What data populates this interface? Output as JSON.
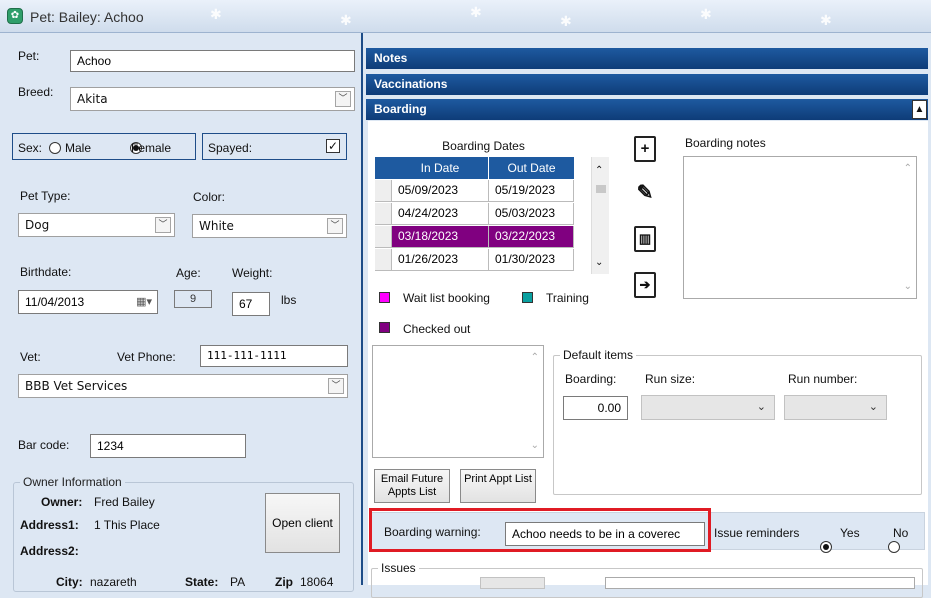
{
  "window": {
    "title": "Pet: Bailey: Achoo"
  },
  "pet": {
    "pet_label": "Pet:",
    "pet_value": "Achoo",
    "breed_label": "Breed:",
    "breed_value": "Akita",
    "sex_label": "Sex:",
    "sex_male": "Male",
    "sex_female": "Female",
    "sex_selected": "Female",
    "spayed_label": "Spayed:",
    "spayed_checked": true,
    "pet_type_label": "Pet Type:",
    "pet_type_value": "Dog",
    "color_label": "Color:",
    "color_value": "White",
    "birthdate_label": "Birthdate:",
    "birthdate_value": "11/04/2013",
    "age_label": "Age:",
    "age_value": "9",
    "weight_label": "Weight:",
    "weight_value": "67",
    "weight_unit": "lbs",
    "vet_label": "Vet:",
    "vet_phone_label": "Vet Phone:",
    "vet_phone_value": "111-111-1111",
    "vet_value": "BBB Vet Services",
    "barcode_label": "Bar code:",
    "barcode_value": "1234"
  },
  "owner": {
    "group_title": "Owner Information",
    "owner_label": "Owner:",
    "owner_value": "Fred Bailey",
    "address1_label": "Address1:",
    "address1_value": "1 This Place",
    "address2_label": "Address2:",
    "address2_value": "",
    "open_client_label": "Open client",
    "city_label": "City:",
    "city_value": "nazareth",
    "state_label": "State:",
    "state_value": "PA",
    "zip_label": "Zip",
    "zip_value": "18064"
  },
  "sections": {
    "notes": "Notes",
    "vaccinations": "Vaccinations",
    "boarding": "Boarding"
  },
  "boarding": {
    "dates_title": "Boarding Dates",
    "col_in": "In Date",
    "col_out": "Out Date",
    "rows": [
      {
        "in": "05/09/2023",
        "out": "05/19/2023",
        "kind": "normal"
      },
      {
        "in": "04/24/2023",
        "out": "05/03/2023",
        "kind": "normal"
      },
      {
        "in": "03/18/2023",
        "out": "03/22/2023",
        "kind": "checked_out"
      },
      {
        "in": "01/26/2023",
        "out": "01/30/2023",
        "kind": "normal"
      }
    ],
    "legend_wait": "Wait list booking",
    "legend_training": "Training",
    "legend_checked": "Checked out",
    "colors": {
      "wait": "#ff00ff",
      "training": "#0aa0a0",
      "checked": "#800080"
    },
    "notes_label": "Boarding notes",
    "default_items_label": "Default items",
    "boarding_label": "Boarding:",
    "boarding_value": "0.00",
    "run_size_label": "Run size:",
    "run_number_label": "Run number:",
    "email_btn": "Email Future Appts List",
    "print_btn": "Print Appt List",
    "warning_label": "Boarding warning:",
    "warning_value": "Achoo needs to be in a coverec",
    "reminders_label": "Issue reminders",
    "yes": "Yes",
    "no": "No",
    "reminders_selected": "Yes",
    "issues_label": "Issues",
    "highlight_color": "#e01b24"
  }
}
